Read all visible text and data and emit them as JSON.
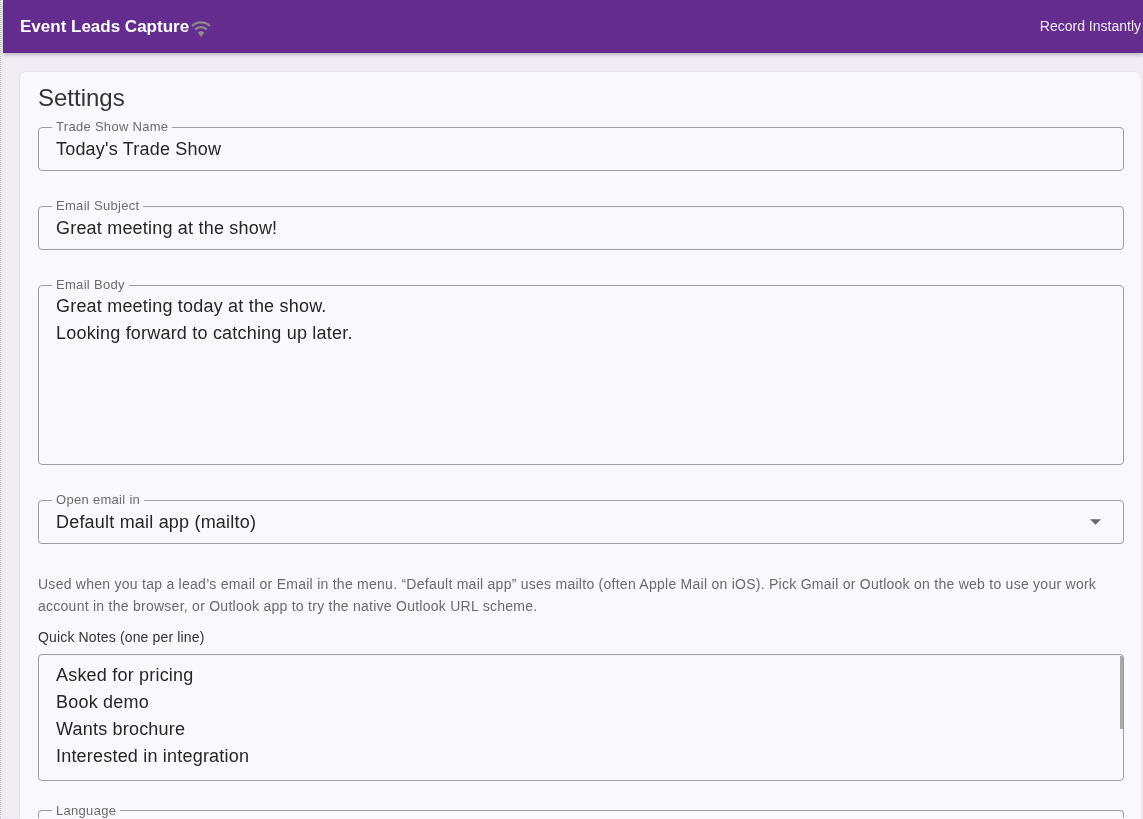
{
  "header": {
    "title": "Event Leads Capture",
    "action": "Record Instantly"
  },
  "settings": {
    "title": "Settings",
    "items": [
      {
        "kind": "text",
        "label": "Trade Show Name",
        "value": "Today's Trade Show"
      },
      {
        "kind": "text",
        "label": "Email Subject",
        "value": "Great meeting at the show!"
      },
      {
        "kind": "textarea",
        "label": "Email Body",
        "lines": [
          "Great meeting today at the show.",
          "Looking forward to catching up later."
        ]
      },
      {
        "kind": "select",
        "label": "Open email in",
        "value": "Default mail app (mailto)"
      },
      {
        "kind": "help",
        "text": "Used when you tap a lead’s email or Email in the menu. “Default mail app” uses mailto (often Apple Mail on iOS). Pick Gmail or Outlook on the web to use your work account in the browser, or Outlook app to try the native Outlook URL scheme."
      },
      {
        "kind": "notes",
        "label": "Quick Notes (one per line)",
        "lines": [
          "Asked for pricing",
          "Book demo",
          "Wants brochure",
          "Interested in integration"
        ]
      },
      {
        "kind": "text",
        "label": "Language"
      }
    ]
  }
}
